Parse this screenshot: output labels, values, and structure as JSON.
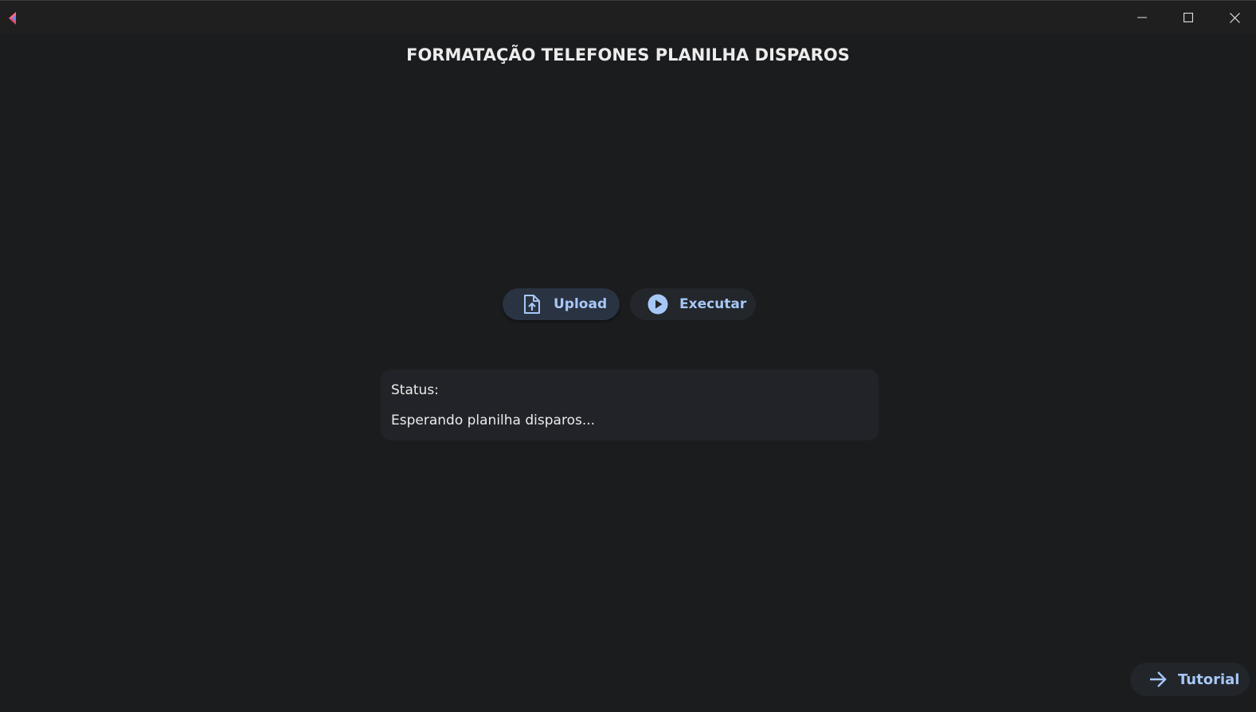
{
  "window": {
    "controls": {
      "minimize_icon": "minimize-icon",
      "maximize_icon": "maximize-icon",
      "close_icon": "close-icon"
    }
  },
  "app": {
    "title": "FORMATAÇÃO TELEFONES PLANILHA DISPAROS",
    "accent_color": "#a7c8f7",
    "background_color": "#1b1c1e"
  },
  "actions": {
    "upload": {
      "label": "Upload",
      "icon": "file-upload-icon"
    },
    "execute": {
      "label": "Executar",
      "icon": "play-circle-icon"
    }
  },
  "status": {
    "label": "Status:",
    "message": "Esperando planilha disparos..."
  },
  "footer": {
    "tutorial": {
      "label": "Tutorial",
      "icon": "arrow-right-icon"
    }
  }
}
